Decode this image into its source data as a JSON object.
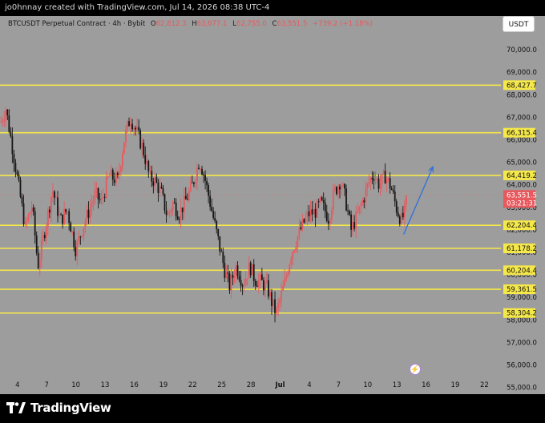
{
  "header": {
    "credit": "jo0hnnay created with TradingView.com, Jul 14, 2026 08:38 UTC-4"
  },
  "legend": {
    "symbol": "BTCUSDT Perpetual Contract · 4h · Bybit",
    "open_label": "O",
    "open": "62,812.3",
    "high_label": "H",
    "high": "63,677.1",
    "low_label": "L",
    "low": "62,755.0",
    "close_label": "C",
    "close": "63,551.5",
    "change": "+739.2 (+1.18%)"
  },
  "currency_button": "USDT",
  "colors": {
    "background": "#9d9d9d",
    "up": "#e8595e",
    "down": "#161616",
    "level_line": "#f5e84a",
    "arrow": "#2f6fde",
    "last_price_tag": "#e8595e"
  },
  "chart_data": {
    "type": "candlestick",
    "timeframe": "4h",
    "ylim": [
      54700,
      71500
    ],
    "grid": false,
    "y_ticks": [
      55000,
      56000,
      57000,
      58000,
      59000,
      60000,
      61000,
      62000,
      63000,
      64000,
      65000,
      66000,
      67000,
      68000,
      69000,
      70000
    ],
    "y_tick_labels": [
      "55,000.0",
      "56,000.0",
      "57,000.0",
      "58,000.0",
      "59,000.0",
      "60,000.0",
      "61,000.0",
      "62,000.0",
      "63,000.0",
      "64,000.0",
      "65,000.0",
      "66,000.0",
      "67,000.0",
      "68,000.0",
      "69,000.0",
      "70,000.0"
    ],
    "x_ticks": [
      {
        "label": "4",
        "day": 4
      },
      {
        "label": "7",
        "day": 7
      },
      {
        "label": "10",
        "day": 10
      },
      {
        "label": "13",
        "day": 13
      },
      {
        "label": "16",
        "day": 16
      },
      {
        "label": "19",
        "day": 19
      },
      {
        "label": "22",
        "day": 22
      },
      {
        "label": "25",
        "day": 25
      },
      {
        "label": "28",
        "day": 28
      },
      {
        "label": "Jul",
        "day": 31
      },
      {
        "label": "4",
        "day": 34
      },
      {
        "label": "7",
        "day": 37
      },
      {
        "label": "10",
        "day": 40
      },
      {
        "label": "13",
        "day": 43
      },
      {
        "label": "16",
        "day": 46
      },
      {
        "label": "19",
        "day": 49
      },
      {
        "label": "22",
        "day": 52
      }
    ],
    "x_range": [
      2.2,
      53.7
    ],
    "price_path": [
      [
        2.3,
        66800
      ],
      [
        2.8,
        67400
      ],
      [
        3.5,
        65600
      ],
      [
        4.2,
        63700
      ],
      [
        4.8,
        62100
      ],
      [
        5.5,
        63100
      ],
      [
        6.1,
        60400
      ],
      [
        6.9,
        62200
      ],
      [
        7.6,
        63800
      ],
      [
        8.4,
        62400
      ],
      [
        9.1,
        62900
      ],
      [
        10.0,
        61100
      ],
      [
        10.6,
        62000
      ],
      [
        11.3,
        62800
      ],
      [
        12.0,
        63600
      ],
      [
        12.6,
        63200
      ],
      [
        13.4,
        64400
      ],
      [
        14.3,
        64200
      ],
      [
        15.0,
        66100
      ],
      [
        15.6,
        67000
      ],
      [
        16.3,
        66300
      ],
      [
        16.9,
        65600
      ],
      [
        17.6,
        64300
      ],
      [
        18.1,
        64200
      ],
      [
        18.8,
        63600
      ],
      [
        19.4,
        62600
      ],
      [
        20.0,
        63200
      ],
      [
        20.6,
        62700
      ],
      [
        21.4,
        63400
      ],
      [
        22.0,
        64000
      ],
      [
        22.7,
        65100
      ],
      [
        23.2,
        64400
      ],
      [
        23.8,
        63200
      ],
      [
        24.3,
        62200
      ],
      [
        24.9,
        61000
      ],
      [
        25.3,
        60200
      ],
      [
        25.8,
        59500
      ],
      [
        26.5,
        60400
      ],
      [
        27.2,
        59600
      ],
      [
        27.9,
        60400
      ],
      [
        28.4,
        59800
      ],
      [
        29.0,
        59700
      ],
      [
        29.7,
        59400
      ],
      [
        30.2,
        58700
      ],
      [
        30.6,
        58300
      ],
      [
        31.0,
        58900
      ],
      [
        31.5,
        59700
      ],
      [
        32.1,
        60900
      ],
      [
        32.7,
        61600
      ],
      [
        33.3,
        62200
      ],
      [
        33.9,
        62700
      ],
      [
        34.6,
        62800
      ],
      [
        35.2,
        63200
      ],
      [
        36.0,
        62500
      ],
      [
        36.5,
        63600
      ],
      [
        37.2,
        64200
      ],
      [
        37.7,
        63400
      ],
      [
        38.3,
        62000
      ],
      [
        38.9,
        62600
      ],
      [
        39.5,
        63300
      ],
      [
        40.1,
        64100
      ],
      [
        40.6,
        64500
      ],
      [
        41.2,
        64000
      ],
      [
        41.8,
        64400
      ],
      [
        42.4,
        63900
      ],
      [
        43.0,
        62900
      ],
      [
        43.5,
        62400
      ],
      [
        43.8,
        62800
      ],
      [
        44.1,
        63551.5
      ]
    ],
    "levels": [
      {
        "value": 68427.7,
        "label": "68,427.7"
      },
      {
        "value": 66315.4,
        "label": "66,315.4"
      },
      {
        "value": 64419.2,
        "label": "64,419.2"
      },
      {
        "value": 62204.4,
        "label": "62,204.4"
      },
      {
        "value": 61178.2,
        "label": "61,178.2"
      },
      {
        "value": 60204.4,
        "label": "60,204.4"
      },
      {
        "value": 59361.5,
        "label": "59,361.5"
      },
      {
        "value": 58304.2,
        "label": "58,304.2"
      }
    ],
    "last_price": {
      "value": 63551.5,
      "label": "63,551.5",
      "countdown": "03:21:31"
    },
    "arrow": {
      "from": [
        43.7,
        61800
      ],
      "to": [
        46.7,
        64800
      ]
    }
  },
  "footer": {
    "brand": "TradingView"
  }
}
